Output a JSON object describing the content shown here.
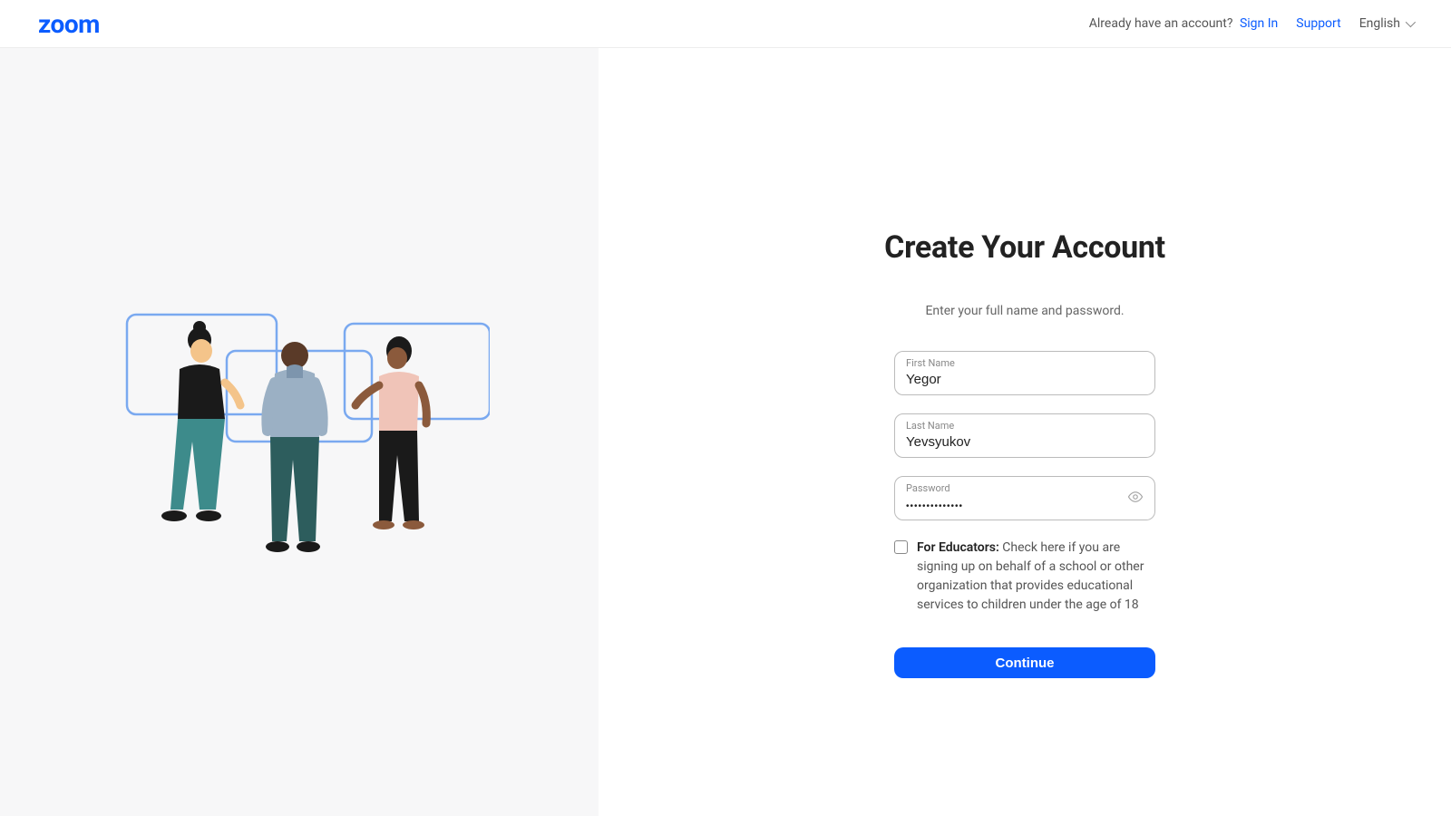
{
  "header": {
    "logo_text": "zoom",
    "already_have_text": "Already have an account?",
    "sign_in": "Sign In",
    "support": "Support",
    "language": "English"
  },
  "form": {
    "title": "Create Your Account",
    "subtitle": "Enter your full name and password.",
    "first_name_label": "First Name",
    "first_name_value": "Yegor",
    "last_name_label": "Last Name",
    "last_name_value": "Yevsyukov",
    "password_label": "Password",
    "password_value": "••••••••••••••",
    "educators_bold": "For Educators:",
    "educators_text": " Check here if you are signing up on behalf of a school or other organization that provides educational services to children under the age of 18",
    "continue_label": "Continue"
  }
}
